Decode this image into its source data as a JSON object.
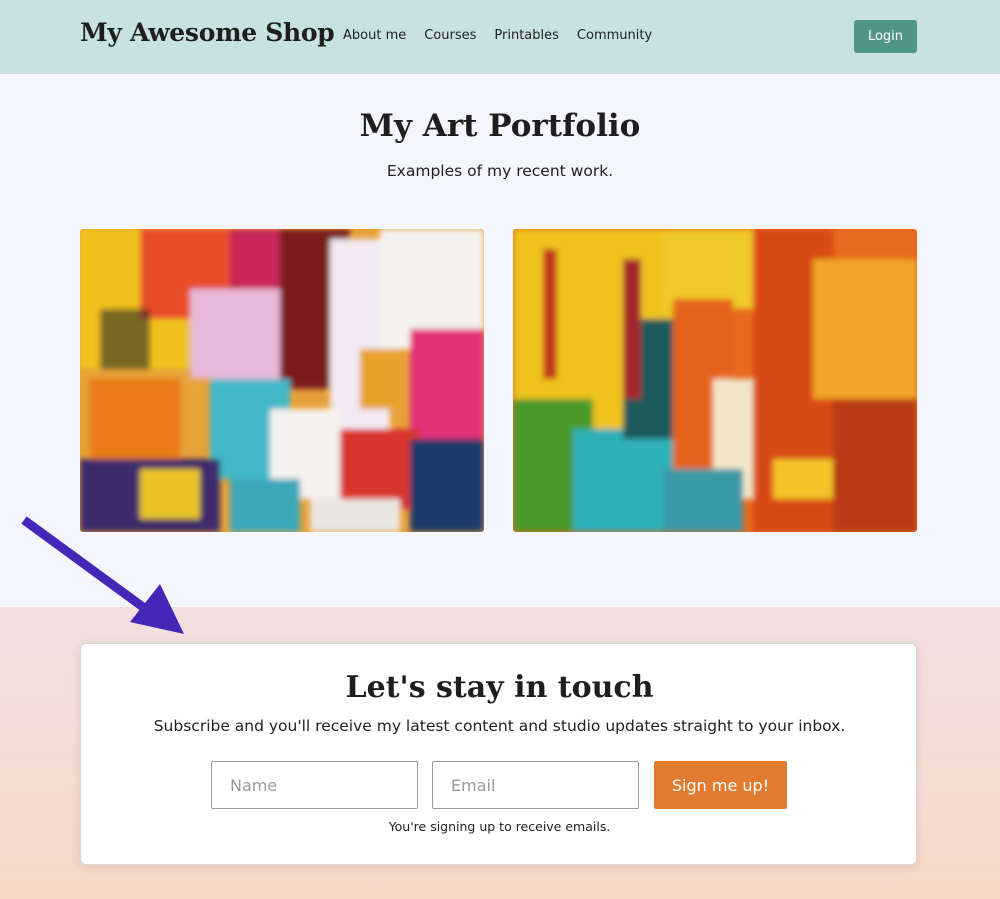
{
  "header": {
    "brand": "My Awesome Shop",
    "nav": [
      "About me",
      "Courses",
      "Printables",
      "Community"
    ],
    "login_label": "Login"
  },
  "portfolio": {
    "title": "My Art Portfolio",
    "subtitle": "Examples of my recent work."
  },
  "subscribe": {
    "title": "Let's stay in touch",
    "subtitle": "Subscribe and you'll receive my latest content and studio updates straight to your inbox.",
    "name_placeholder": "Name",
    "email_placeholder": "Email",
    "button_label": "Sign me up!",
    "note": "You're signing up to receive emails."
  },
  "colors": {
    "header_bg": "#c8e2e2",
    "login_button": "#4f9689",
    "signup_button": "#e07b2f",
    "arrow": "#4526b8"
  },
  "icons": [
    "arrow-annotation-icon"
  ]
}
